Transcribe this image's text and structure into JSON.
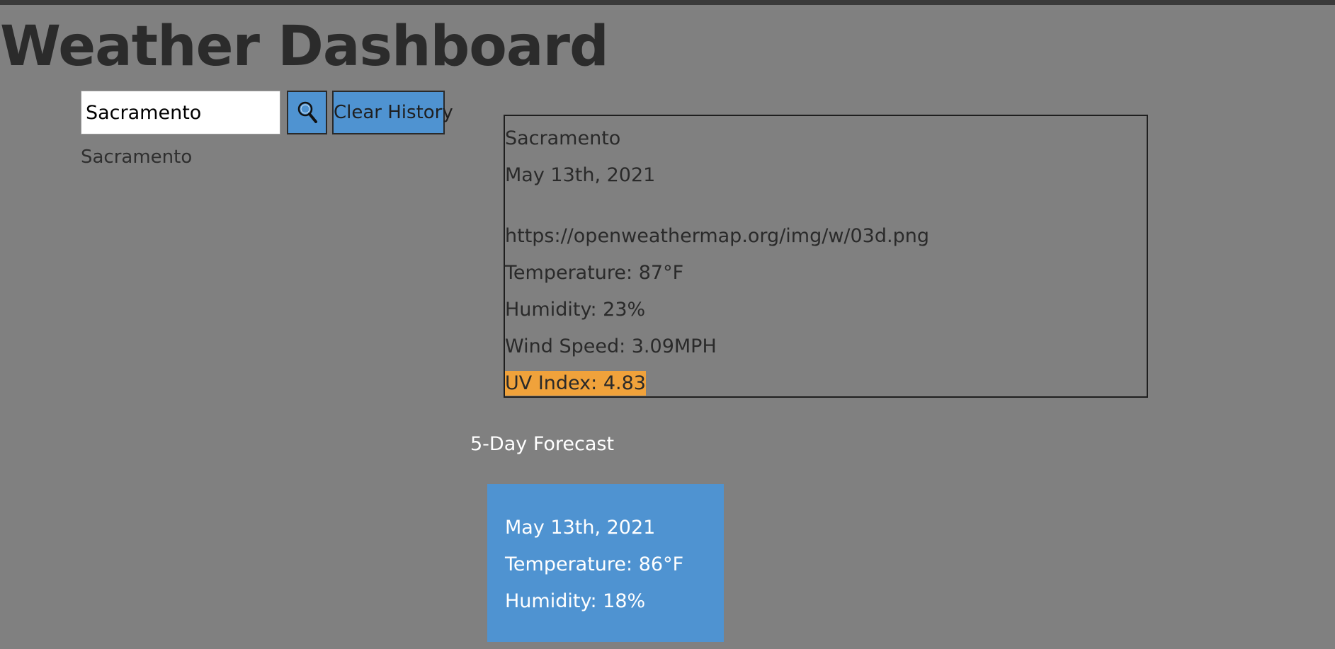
{
  "header": {
    "title": "Weather Dashboard"
  },
  "search": {
    "value": "Sacramento",
    "button_icon": "search-icon",
    "clear_label": "Clear History"
  },
  "history": [
    "Sacramento"
  ],
  "current": {
    "city": "Sacramento",
    "date": "May 13th, 2021",
    "icon_url_text": "https://openweathermap.org/img/w/03d.png",
    "temperature": "Temperature: 87°F",
    "humidity": "Humidity: 23%",
    "wind": "Wind Speed: 3.09MPH",
    "uv": "UV Index: 4.83"
  },
  "forecast": {
    "heading": "5-Day Forecast",
    "days": [
      {
        "date": "May 13th, 2021",
        "temperature": "Temperature: 86°F",
        "humidity": "Humidity: 18%"
      }
    ]
  },
  "colors": {
    "background": "#808080",
    "accent": "#4f93d1",
    "uv_moderate": "#f0a23b"
  }
}
